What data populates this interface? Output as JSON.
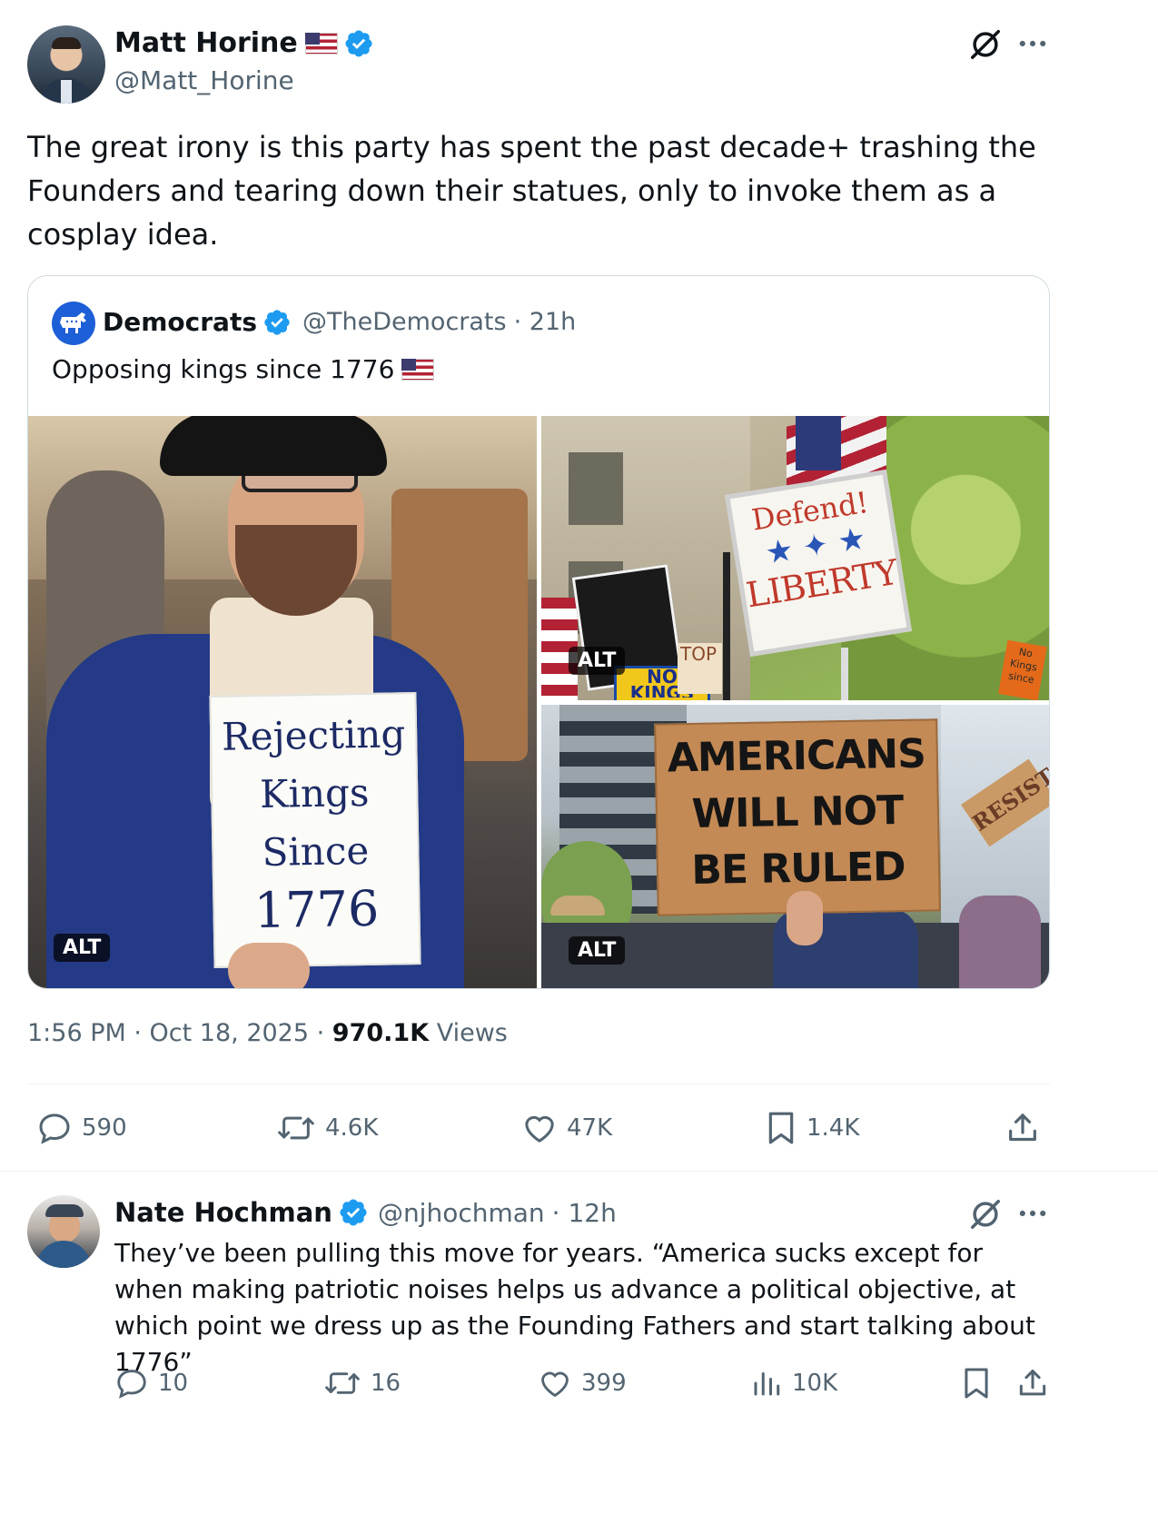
{
  "main_tweet": {
    "author_name": "Matt Horine",
    "author_handle": "@Matt_Horine",
    "text": "The great irony is this party has spent the past decade+ trashing the Founders and tearing down their statues, only to invoke them as a cosplay idea.",
    "timestamp": "1:56 PM · Oct 18, 2025 · ",
    "views_count": "970.1K",
    "views_label": " Views",
    "stats": {
      "replies": "590",
      "reposts": "4.6K",
      "likes": "47K",
      "bookmarks": "1.4K"
    }
  },
  "quoted_tweet": {
    "author_name": "Democrats",
    "author_handle": "@TheDemocrats",
    "age": "· 21h",
    "text": "Opposing kings since 1776",
    "media": [
      {
        "alt_badge": "ALT",
        "sign_text": [
          "Rejecting",
          "Kings",
          "Since",
          "1776"
        ]
      },
      {
        "alt_badge": "ALT",
        "sign_text": [
          "Defend!",
          "LIBERTY"
        ],
        "small_sign": [
          "NO",
          "KINGS"
        ],
        "edge_sign": "TOP",
        "corner_sign": [
          "No",
          "Kings",
          "since"
        ]
      },
      {
        "alt_badge": "ALT",
        "sign_text": [
          "AMERICANS",
          "WILL NOT",
          "BE RULED"
        ],
        "side_sign": "RESIST"
      }
    ]
  },
  "reply": {
    "author_name": "Nate Hochman",
    "author_handle": "@njhochman",
    "age": "· 12h",
    "text": "They’ve been pulling this move for years. “America sucks except for when making patriotic noises helps us advance a political objective, at which point we dress up as the Founding Fathers and start talking about 1776”",
    "stats": {
      "replies": "10",
      "reposts": "16",
      "likes": "399",
      "views": "10K"
    }
  },
  "colors": {
    "text_primary": "#0f1419",
    "text_secondary": "#536471",
    "verified_blue": "#1d9bf0",
    "border": "#cfd9de"
  }
}
